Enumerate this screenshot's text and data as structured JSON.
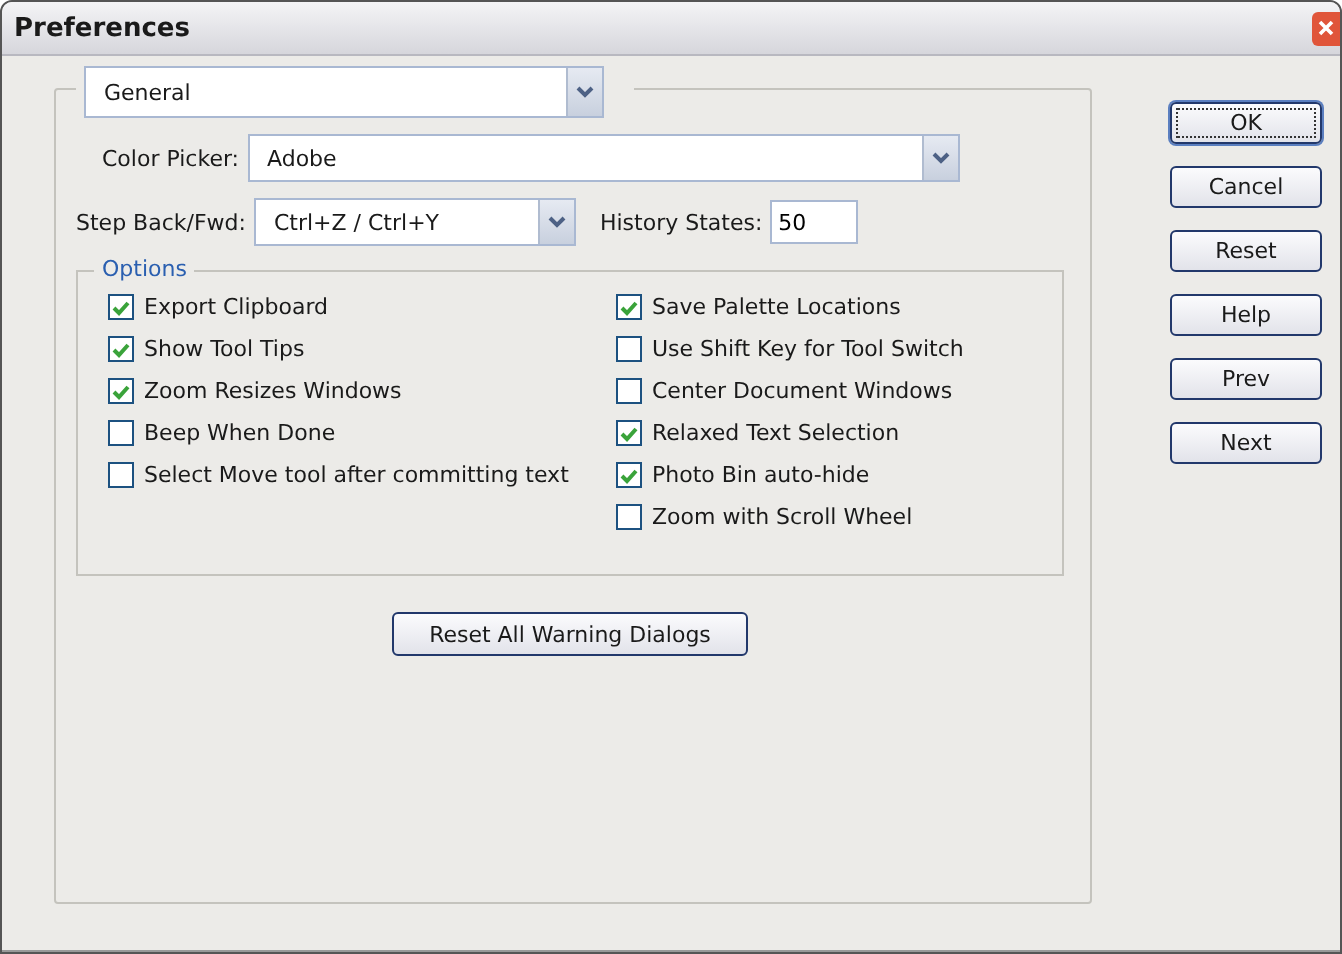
{
  "window": {
    "title": "Preferences"
  },
  "section_select": {
    "value": "General"
  },
  "color_picker": {
    "label": "Color Picker:",
    "value": "Adobe"
  },
  "step_back": {
    "label": "Step Back/Fwd:",
    "value": "Ctrl+Z / Ctrl+Y"
  },
  "history_states": {
    "label": "History States:",
    "value": "50"
  },
  "options": {
    "title": "Options",
    "columns": [
      [
        {
          "label": "Export Clipboard",
          "checked": true
        },
        {
          "label": "Show Tool Tips",
          "checked": true
        },
        {
          "label": "Zoom Resizes Windows",
          "checked": true
        },
        {
          "label": "Beep When Done",
          "checked": false
        },
        {
          "label": "Select Move tool after committing text",
          "checked": false
        }
      ],
      [
        {
          "label": "Save Palette Locations",
          "checked": true
        },
        {
          "label": "Use Shift Key for Tool Switch",
          "checked": false
        },
        {
          "label": "Center Document Windows",
          "checked": false
        },
        {
          "label": "Relaxed Text Selection",
          "checked": true
        },
        {
          "label": "Photo Bin auto-hide",
          "checked": true
        },
        {
          "label": "Zoom with Scroll Wheel",
          "checked": false
        }
      ]
    ]
  },
  "reset_warnings": {
    "label": "Reset All Warning Dialogs"
  },
  "buttons": [
    {
      "label": "OK",
      "default": true
    },
    {
      "label": "Cancel",
      "default": false
    },
    {
      "label": "Reset",
      "default": false
    },
    {
      "label": "Help",
      "default": false
    },
    {
      "label": "Prev",
      "default": false
    },
    {
      "label": "Next",
      "default": false
    }
  ]
}
